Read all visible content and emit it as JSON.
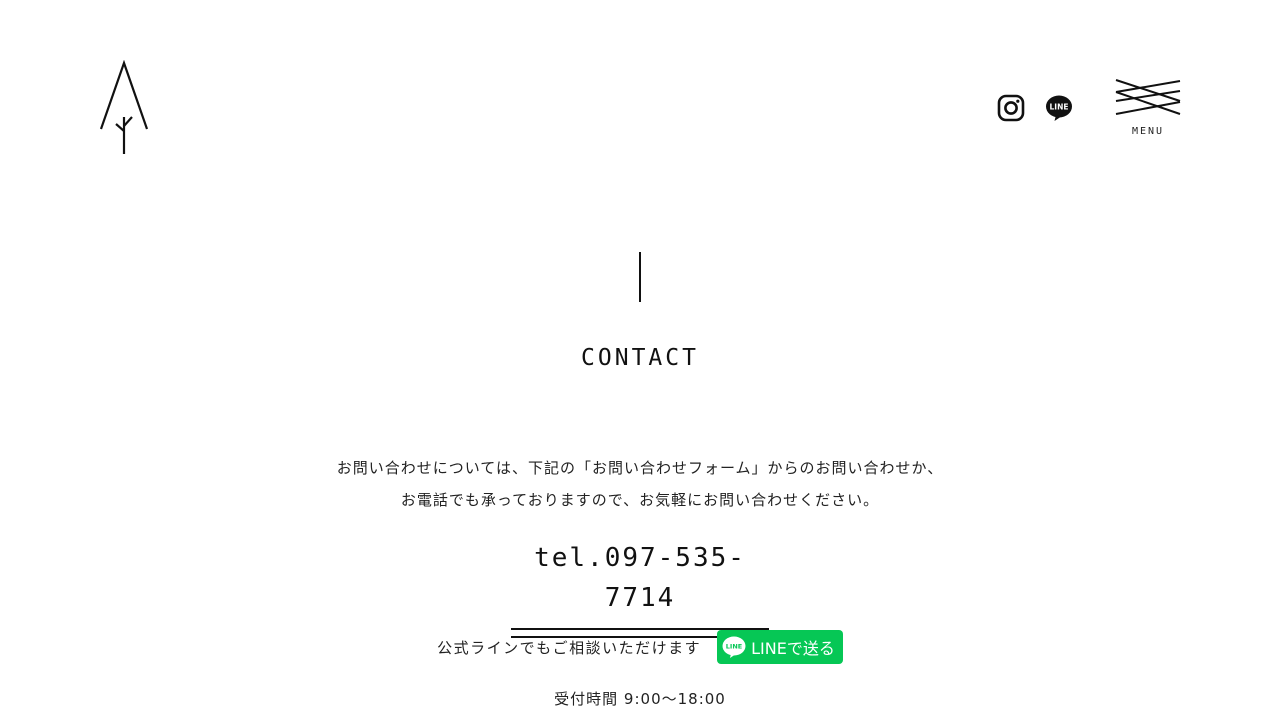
{
  "header": {
    "logo": "tree-logo",
    "social": [
      {
        "name": "Instagram",
        "icon": "instagram-icon"
      },
      {
        "name": "LINE",
        "icon": "line-icon",
        "label": "LINE"
      }
    ],
    "menu": {
      "label": "MENU",
      "icon": "menu-icon"
    }
  },
  "contact": {
    "title": "CONTACT",
    "lead_line1": "お問い合わせについては、下記の「お問い合わせフォーム」からのお問い合わせか、",
    "lead_line2": "お電話でも承っておりますので、お気軽にお問い合わせください。",
    "tel": "tel.097-535-7714",
    "line_text": "公式ラインでもご相談いただけます",
    "line_button": "LINEで送る",
    "hours": "受付時間 9:00〜18:00"
  },
  "colors": {
    "text": "#111111",
    "background": "#ffffff",
    "line_green": "#06c755"
  }
}
